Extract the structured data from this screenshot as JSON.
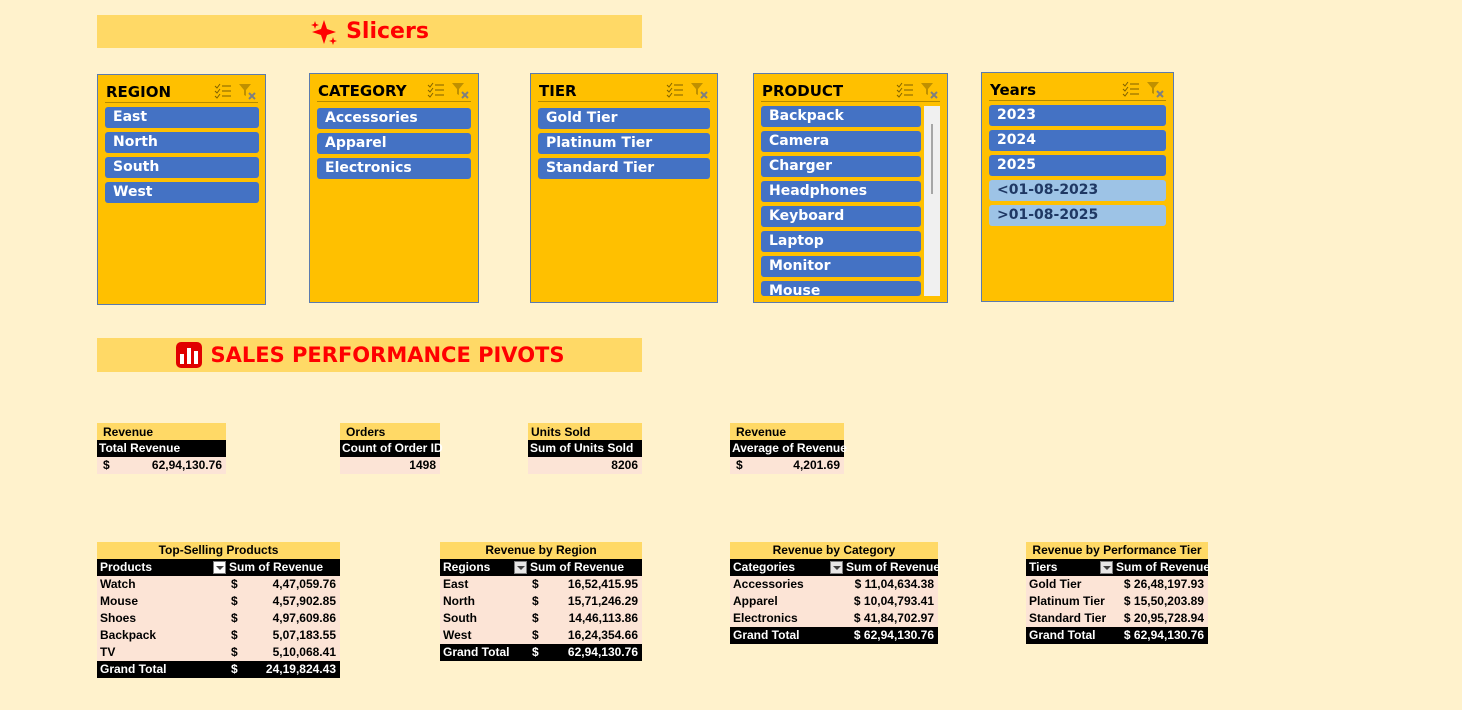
{
  "slicers_banner": {
    "title": "Slicers",
    "icon": "sparkle-icon"
  },
  "pivots_banner": {
    "title": "SALES PERFORMANCE PIVOTS",
    "icon": "bar-chart-icon"
  },
  "slicers": {
    "region": {
      "title": "REGION",
      "items": [
        "East",
        "North",
        "South",
        "West"
      ]
    },
    "category": {
      "title": "CATEGORY",
      "items": [
        "Accessories",
        "Apparel",
        "Electronics"
      ]
    },
    "tier": {
      "title": "TIER",
      "items": [
        "Gold Tier",
        "Platinum Tier",
        "Standard Tier"
      ]
    },
    "product": {
      "title": "PRODUCT",
      "items": [
        "Backpack",
        "Camera",
        "Charger",
        "Headphones",
        "Keyboard",
        "Laptop",
        "Monitor",
        "Mouse"
      ]
    },
    "years": {
      "title": "Years",
      "items": [
        "2023",
        "2024",
        "2025",
        "<01-08-2023",
        ">01-08-2025"
      ]
    }
  },
  "kpis": {
    "total_revenue": {
      "caption": "Revenue",
      "header": "Total Revenue",
      "currency": "$",
      "value": "62,94,130.76"
    },
    "orders": {
      "caption": "Orders",
      "header": "Count of Order ID",
      "currency": "",
      "value": "1498"
    },
    "units": {
      "caption": "Units Sold",
      "header": "Sum of Units Sold",
      "currency": "",
      "value": "8206"
    },
    "avg_revenue": {
      "caption": "Revenue",
      "header": "Average of Revenue",
      "currency": "$",
      "value": "4,201.69"
    }
  },
  "pivots": {
    "products": {
      "caption": "Top-Selling Products",
      "col1": "Products",
      "col2": "Sum of Revenue",
      "rows": [
        {
          "label": "Watch",
          "cur": "$",
          "value": "4,47,059.76"
        },
        {
          "label": "Mouse",
          "cur": "$",
          "value": "4,57,902.85"
        },
        {
          "label": "Shoes",
          "cur": "$",
          "value": "4,97,609.86"
        },
        {
          "label": "Backpack",
          "cur": "$",
          "value": "5,07,183.55"
        },
        {
          "label": "TV",
          "cur": "$",
          "value": "5,10,068.41"
        }
      ],
      "total": {
        "label": "Grand Total",
        "cur": "$",
        "value": "24,19,824.43"
      }
    },
    "regions": {
      "caption": "Revenue by Region",
      "col1": "Regions",
      "col2": "Sum of Revenue",
      "rows": [
        {
          "label": "East",
          "cur": "$",
          "value": "16,52,415.95"
        },
        {
          "label": "North",
          "cur": "$",
          "value": "15,71,246.29"
        },
        {
          "label": "South",
          "cur": "$",
          "value": "14,46,113.86"
        },
        {
          "label": "West",
          "cur": "$",
          "value": "16,24,354.66"
        }
      ],
      "total": {
        "label": "Grand Total",
        "cur": "$",
        "value": "62,94,130.76"
      }
    },
    "categories": {
      "caption": "Revenue by Category",
      "col1": "Categories",
      "col2": "Sum of Revenue",
      "rows": [
        {
          "label": "Accessories",
          "cur": "",
          "value": "$ 11,04,634.38"
        },
        {
          "label": "Apparel",
          "cur": "",
          "value": "$ 10,04,793.41"
        },
        {
          "label": "Electronics",
          "cur": "",
          "value": "$ 41,84,702.97"
        }
      ],
      "total": {
        "label": "Grand Total",
        "cur": "",
        "value": "$ 62,94,130.76"
      }
    },
    "tiers": {
      "caption": "Revenue by Performance Tier",
      "col1": "Tiers",
      "col2": "Sum of Revenue",
      "rows": [
        {
          "label": "Gold Tier",
          "cur": "",
          "value": "$ 26,48,197.93"
        },
        {
          "label": "Platinum Tier",
          "cur": "",
          "value": "$ 15,50,203.89"
        },
        {
          "label": "Standard Tier",
          "cur": "",
          "value": "$ 20,95,728.94"
        }
      ],
      "total": {
        "label": "Grand Total",
        "cur": "",
        "value": "$ 62,94,130.76"
      }
    }
  }
}
